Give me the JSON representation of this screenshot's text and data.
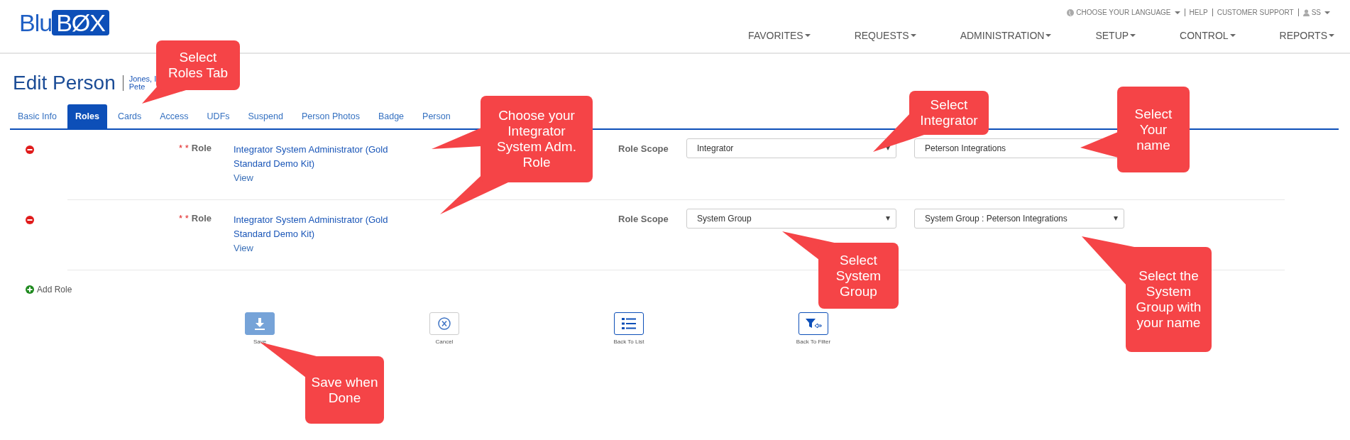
{
  "logo": {
    "light": "Blu",
    "boxed": "BØX"
  },
  "top_links": [
    {
      "kind": "language",
      "label": "CHOOSE YOUR LANGUAGE"
    },
    {
      "kind": "plain",
      "label": "HELP"
    },
    {
      "kind": "plain",
      "label": "CUSTOMER SUPPORT"
    },
    {
      "kind": "user",
      "label": "SS"
    }
  ],
  "nav": [
    "FAVORITES",
    "REQUESTS",
    "ADMINISTRATION",
    "SETUP",
    "CONTROL",
    "REPORTS"
  ],
  "page_title": "Edit Person",
  "person_lines": [
    "Jones, I",
    "Pete"
  ],
  "tabs": [
    {
      "label": "Basic Info",
      "selected": false
    },
    {
      "label": "Roles",
      "selected": true
    },
    {
      "label": "Cards",
      "selected": false
    },
    {
      "label": "Access",
      "selected": false
    },
    {
      "label": "UDFs",
      "selected": false
    },
    {
      "label": "Suspend",
      "selected": false
    },
    {
      "label": "Person Photos",
      "selected": false
    },
    {
      "label": "Badge",
      "selected": false
    },
    {
      "label": "Person",
      "selected": false
    }
  ],
  "roles": [
    {
      "required": "* *",
      "label": "Role",
      "role_name": "Integrator System Administrator (Gold Standard Demo Kit)",
      "view_link": "View",
      "scope_label": "Role Scope",
      "scope": "Integrator",
      "target": "Peterson Integrations"
    },
    {
      "required": "* *",
      "label": "Role",
      "role_name": "Integrator System Administrator (Gold Standard Demo Kit)",
      "view_link": "View",
      "scope_label": "Role Scope",
      "scope": "System Group",
      "target": "System Group : Peterson Integrations"
    }
  ],
  "add_role": "Add Role",
  "actions": [
    {
      "kind": "save",
      "label": "Save"
    },
    {
      "kind": "cancel",
      "label": "Cancel"
    },
    {
      "kind": "list",
      "label": "Back To List"
    },
    {
      "kind": "filter",
      "label": "Back To Filter"
    }
  ],
  "callouts": [
    {
      "text": "Select Roles Tab"
    },
    {
      "text": "Choose your Integrator System Adm. Role"
    },
    {
      "text": "Select Integrator"
    },
    {
      "text": "Select Your name"
    },
    {
      "text": "Select System Group"
    },
    {
      "text": "Select the System Group with your name"
    },
    {
      "text": "Save when Done"
    }
  ]
}
